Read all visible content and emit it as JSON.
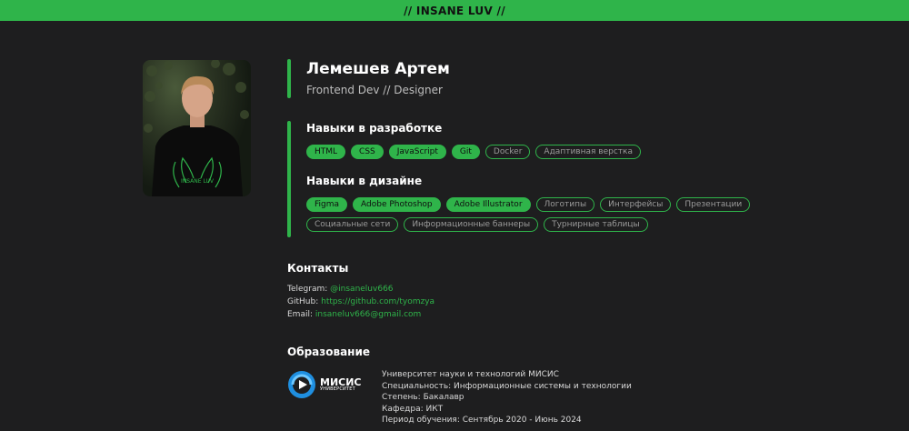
{
  "header": {
    "title": "// INSANE LUV //"
  },
  "profile": {
    "name": "Лемешев Артем",
    "role": "Frontend Dev // Designer",
    "photo_alt": "INSANE LUV"
  },
  "skills_dev": {
    "title": "Навыки в разработке",
    "items": [
      {
        "label": "HTML",
        "filled": true
      },
      {
        "label": "CSS",
        "filled": true
      },
      {
        "label": "JavaScript",
        "filled": true
      },
      {
        "label": "Git",
        "filled": true
      },
      {
        "label": "Docker",
        "filled": false
      },
      {
        "label": "Адаптивная верстка",
        "filled": false
      }
    ]
  },
  "skills_design": {
    "title": "Навыки в дизайне",
    "items": [
      {
        "label": "Figma",
        "filled": true
      },
      {
        "label": "Adobe Photoshop",
        "filled": true
      },
      {
        "label": "Adobe Illustrator",
        "filled": true
      },
      {
        "label": "Логотипы",
        "filled": false
      },
      {
        "label": "Интерфейсы",
        "filled": false
      },
      {
        "label": "Презентации",
        "filled": false
      },
      {
        "label": "Социальные сети",
        "filled": false
      },
      {
        "label": "Информационные баннеры",
        "filled": false
      },
      {
        "label": "Турнирные таблицы",
        "filled": false
      }
    ]
  },
  "contacts": {
    "title": "Контакты",
    "telegram_label": "Telegram:",
    "telegram_value": "@insaneluv666",
    "github_label": "GitHub:",
    "github_value": "https://github.com/tyomzya",
    "email_label": "Email:",
    "email_value": "insaneluv666@gmail.com"
  },
  "education": {
    "title": "Образование",
    "logo_main": "МИСИС",
    "logo_sub": "УНИВЕРСИТЕТ",
    "university": "Университет науки и технологий МИСИС",
    "specialty": "Специальность: Информационные системы и технологии",
    "degree": "Степень: Бакалавр",
    "department": "Кафедра: ИКТ",
    "period": "Период обучения: Сентябрь 2020 - Июнь 2024"
  },
  "colors": {
    "accent": "#2fb44a",
    "background": "#1e1e1f"
  }
}
